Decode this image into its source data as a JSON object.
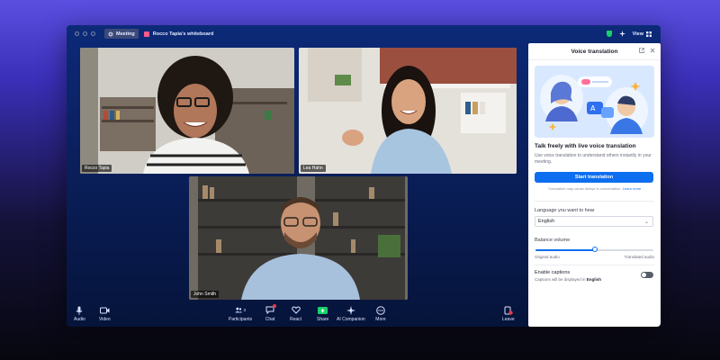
{
  "window": {
    "meeting_label": "Meeting",
    "whiteboard_title": "Rocco Tapia's whiteboard",
    "view_label": "View"
  },
  "participants": [
    {
      "name": "Rocco Tapia"
    },
    {
      "name": "Lea Hahn"
    },
    {
      "name": "John Smith"
    }
  ],
  "toolbar": {
    "audio": "Audio",
    "video": "Video",
    "participants": "Participants",
    "participants_count": "3",
    "chat": "Chat",
    "react": "React",
    "share": "Share",
    "ai_companion": "AI Companion",
    "more": "More",
    "leave": "Leave"
  },
  "panel": {
    "title": "Voice translation",
    "heading": "Talk freely with live voice translation",
    "description": "Use voice translation to understand others instantly in your meeting.",
    "start_button": "Start translation",
    "note": "Translation may cause delays in conversation.",
    "learn_more": "Learn more",
    "language_label": "Language you want to hear",
    "language_value": "English",
    "balance_label": "Balance volume",
    "balance_value": 0.5,
    "balance_left": "Original audio",
    "balance_right": "Translated audio",
    "captions_label": "Enable captions",
    "captions_desc_prefix": "Captions will be displayed in",
    "captions_language": "English",
    "captions_enabled": false
  },
  "colors": {
    "accent": "#0e6ef0",
    "security_green": "#17d16a",
    "chat_badge": "#e8394b"
  }
}
